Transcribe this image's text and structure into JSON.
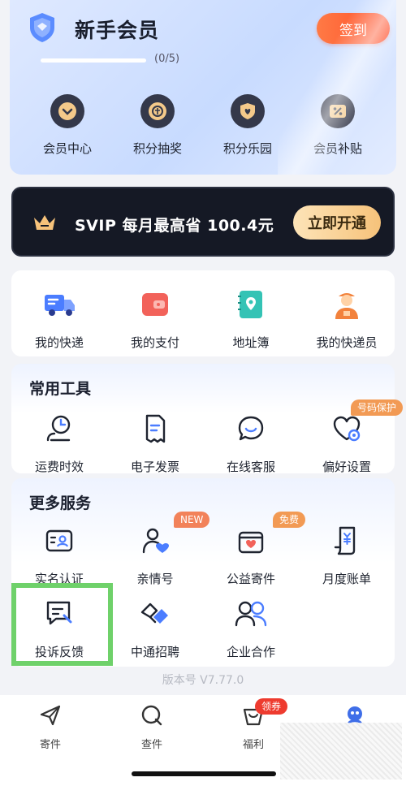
{
  "member": {
    "title": "新手会员",
    "signin": "签到",
    "progress_text": "(0/5)",
    "progress_value": 0,
    "items": [
      {
        "label": "会员中心",
        "icon": "chevron-down-icon"
      },
      {
        "label": "积分抽奖",
        "icon": "coin-icon"
      },
      {
        "label": "积分乐园",
        "icon": "heart-shield-icon"
      },
      {
        "label": "会员补贴",
        "icon": "coupon-icon"
      }
    ]
  },
  "svip": {
    "text": "SVIP 每月最高省 100.4元",
    "button": "立即开通"
  },
  "quick": [
    {
      "label": "我的快递",
      "icon": "truck-icon"
    },
    {
      "label": "我的支付",
      "icon": "wallet-icon"
    },
    {
      "label": "地址簿",
      "icon": "address-book-icon"
    },
    {
      "label": "我的快递员",
      "icon": "courier-icon"
    }
  ],
  "tools": {
    "title": "常用工具",
    "items": [
      {
        "label": "运费时效",
        "icon": "clock-user-icon"
      },
      {
        "label": "电子发票",
        "icon": "invoice-icon"
      },
      {
        "label": "在线客服",
        "icon": "chat-icon"
      },
      {
        "label": "偏好设置",
        "icon": "heart-gear-icon",
        "badge": "号码保护"
      }
    ]
  },
  "services": {
    "title": "更多服务",
    "items": [
      {
        "label": "实名认证",
        "icon": "id-card-icon"
      },
      {
        "label": "亲情号",
        "icon": "family-icon",
        "badge": "NEW"
      },
      {
        "label": "公益寄件",
        "icon": "charity-box-icon",
        "badge": "免费"
      },
      {
        "label": "月度账单",
        "icon": "bill-icon"
      },
      {
        "label": "投诉反馈",
        "icon": "feedback-icon"
      },
      {
        "label": "中通招聘",
        "icon": "handshake-icon"
      },
      {
        "label": "企业合作",
        "icon": "users-icon"
      }
    ]
  },
  "version": "版本号 V7.77.0",
  "nav": [
    {
      "label": "寄件",
      "icon": "send-icon"
    },
    {
      "label": "查件",
      "icon": "search-icon"
    },
    {
      "label": "福利",
      "icon": "gift-icon",
      "badge": "领券"
    },
    {
      "label": "",
      "icon": "profile-icon"
    }
  ],
  "colors": {
    "accent": "#4b7dff",
    "signin": "#ff5a2e",
    "badge": "#f29a54",
    "highlight": "#6fd16a"
  }
}
